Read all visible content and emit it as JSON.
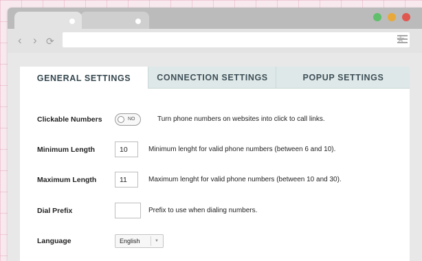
{
  "browser": {
    "back_glyph": "‹",
    "forward_glyph": "›",
    "reload_glyph": "⟳",
    "star_glyph": "★",
    "traffic_colors": {
      "green": "#5fbf6b",
      "yellow": "#e8a93a",
      "red": "#e0574f"
    },
    "icons": [
      "back-icon",
      "forward-icon",
      "reload-icon",
      "bookmark-star-icon",
      "menu-icon"
    ]
  },
  "settings": {
    "tabs": [
      {
        "label": "GENERAL SETTINGS",
        "active": true
      },
      {
        "label": "CONNECTION SETTINGS",
        "active": false
      },
      {
        "label": "POPUP SETTINGS",
        "active": false
      }
    ],
    "rows": {
      "clickable_numbers": {
        "label": "Clickable Numbers",
        "toggle_text": "NO",
        "toggle_on": false,
        "description": "Turn phone numbers on websites into click to call links."
      },
      "minimum_length": {
        "label": "Minimum Length",
        "value": "10",
        "description": "Minimum lenght for valid phone numbers (between 6 and 10)."
      },
      "maximum_length": {
        "label": "Maximum Length",
        "value": "11",
        "description": "Maximum lenght for valid phone numbers (between 10 and 30)."
      },
      "dial_prefix": {
        "label": "Dial Prefix",
        "value": "",
        "description": "Prefix to use when dialing numbers."
      },
      "language": {
        "label": "Language",
        "selected": "English",
        "arrow_glyph": "▼"
      }
    }
  }
}
